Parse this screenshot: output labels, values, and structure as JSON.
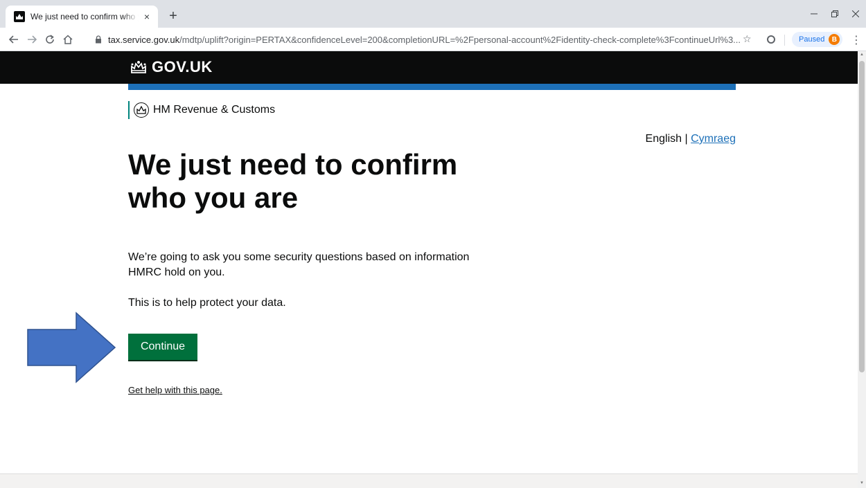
{
  "browser": {
    "tab_title": "We just need to confirm who you are",
    "tab_close": "×",
    "new_tab": "+",
    "url_host": "tax.service.gov.uk",
    "url_path": "/mdtp/uplift?origin=PERTAX&confidenceLevel=200&completionURL=%2Fpersonal-account%2Fidentity-check-complete%3FcontinueUrl%3...",
    "profile_label": "Paused",
    "profile_initial": "B"
  },
  "header": {
    "logo_text": "GOV.UK"
  },
  "department": {
    "name": "HM Revenue & Customs"
  },
  "language": {
    "current": "English",
    "separator": "|",
    "alternate": "Cymraeg"
  },
  "main": {
    "heading": "We just need to confirm who you are",
    "intro": "We’re going to ask you some security questions based on information HMRC hold on you.",
    "purpose": "This is to help protect your data.",
    "continue_label": "Continue",
    "help_link": "Get help with this page."
  },
  "colors": {
    "header_bg": "#0b0c0c",
    "header_underline": "#1d70b8",
    "button_green": "#00703c",
    "link_blue": "#1d70b8",
    "arrow_fill": "#4472c4",
    "arrow_stroke": "#2f528f"
  },
  "icons": [
    "crown-icon",
    "lock-icon",
    "star-icon",
    "back-icon",
    "forward-icon",
    "reload-icon",
    "home-icon",
    "menu-icon"
  ]
}
